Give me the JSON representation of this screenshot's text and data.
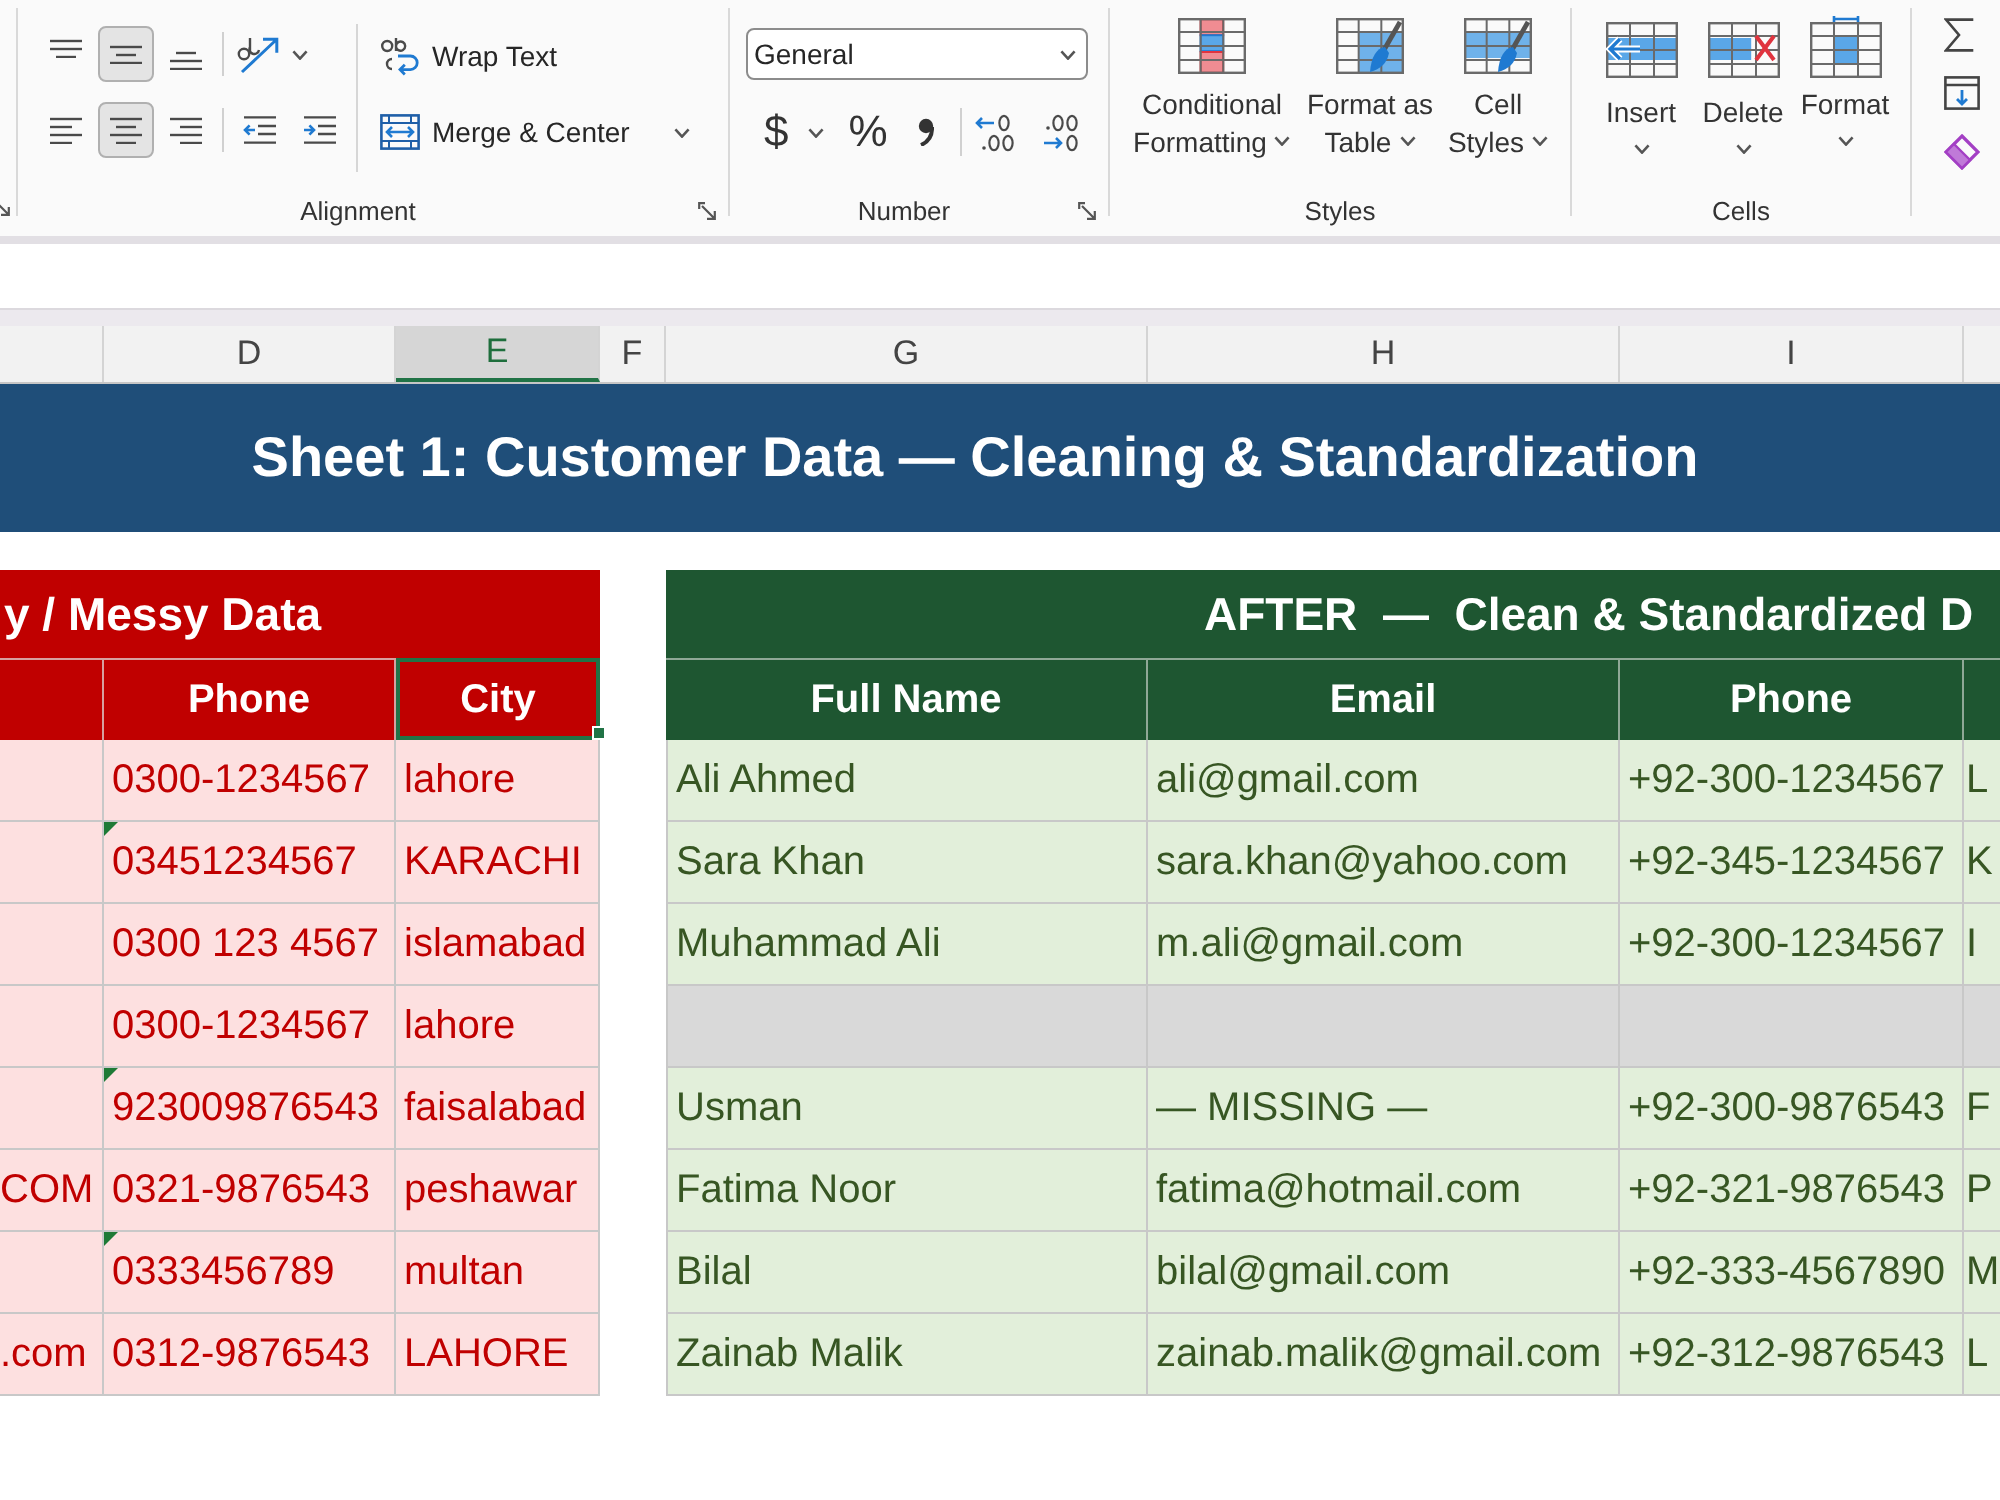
{
  "ribbon": {
    "alignment": {
      "label": "Alignment",
      "vertical": [
        {
          "kind": "top",
          "selected": false
        },
        {
          "kind": "middle",
          "selected": true
        },
        {
          "kind": "bottom",
          "selected": false
        }
      ],
      "horizontal": [
        {
          "kind": "left",
          "selected": false
        },
        {
          "kind": "center",
          "selected": true
        },
        {
          "kind": "right",
          "selected": false
        }
      ],
      "wrap_text": "Wrap Text",
      "merge_center": "Merge & Center"
    },
    "number": {
      "label": "Number",
      "format": "General",
      "currency": "$",
      "percent": "%"
    },
    "styles": {
      "label": "Styles",
      "buttons": [
        {
          "kind": "conditional",
          "lines": [
            "Conditional",
            "Formatting"
          ]
        },
        {
          "kind": "table",
          "lines": [
            "Format as",
            "Table"
          ]
        },
        {
          "kind": "cell_styles",
          "lines": [
            "Cell",
            "Styles"
          ]
        }
      ]
    },
    "cells": {
      "label": "Cells",
      "buttons": [
        {
          "kind": "insert",
          "label": "Insert"
        },
        {
          "kind": "delete",
          "label": "Delete"
        },
        {
          "kind": "format",
          "label": "Format"
        }
      ]
    }
  },
  "sheet": {
    "column_headers": [
      {
        "label": "D",
        "selected": false
      },
      {
        "label": "E",
        "selected": true
      },
      {
        "label": "F",
        "selected": false
      },
      {
        "label": "G",
        "selected": false
      },
      {
        "label": "H",
        "selected": false
      },
      {
        "label": "I",
        "selected": false
      }
    ],
    "title": "Sheet 1: Customer Data — Cleaning & Standardization",
    "before": {
      "title": "y / Messy Data",
      "columns": [
        {
          "label": "Phone",
          "selected": false
        },
        {
          "label": "City",
          "selected": true
        }
      ],
      "rows": [
        {
          "phone": "0300-1234567",
          "city": "lahore",
          "error_flag": false
        },
        {
          "phone": "03451234567",
          "city": "KARACHI",
          "error_flag": true
        },
        {
          "phone": "0300 123 4567",
          "city": "islamabad",
          "error_flag": false
        },
        {
          "phone": "0300-1234567",
          "city": "lahore",
          "error_flag": false
        },
        {
          "phone": "923009876543",
          "city": "faisalabad",
          "error_flag": true
        },
        {
          "column_c": "COM",
          "phone": "0321-9876543",
          "city": "peshawar",
          "error_flag": false
        },
        {
          "phone": "0333456789",
          "city": "multan",
          "error_flag": true
        },
        {
          "column_c": ".com",
          "phone": "0312-9876543",
          "city": "LAHORE",
          "error_flag": false
        }
      ]
    },
    "after": {
      "title": "AFTER  —  Clean & Standardized D",
      "columns": [
        "Full Name",
        "Email",
        "Phone"
      ],
      "rows": [
        {
          "kind": "data",
          "full_name": "Ali Ahmed",
          "email": "ali@gmail.com",
          "phone": "+92-300-1234567",
          "column_4": "L"
        },
        {
          "kind": "data",
          "full_name": "Sara Khan",
          "email": "sara.khan@yahoo.com",
          "phone": "+92-345-1234567",
          "column_4": "K"
        },
        {
          "kind": "data",
          "full_name": "Muhammad Ali",
          "email": "m.ali@gmail.com",
          "phone": "+92-300-1234567",
          "column_4": "I"
        },
        {
          "kind": "blank"
        },
        {
          "kind": "data",
          "full_name": "Usman",
          "email": "— MISSING —",
          "phone": "+92-300-9876543",
          "column_4": "F"
        },
        {
          "kind": "data",
          "full_name": "Fatima Noor",
          "email": "fatima@hotmail.com",
          "phone": "+92-321-9876543",
          "column_4": "P"
        },
        {
          "kind": "data",
          "full_name": "Bilal",
          "email": "bilal@gmail.com",
          "phone": "+92-333-4567890",
          "column_4": "M"
        },
        {
          "kind": "data",
          "full_name": "Zainab Malik",
          "email": "zainab.malik@gmail.com",
          "phone": "+92-312-9876543",
          "column_4": "L"
        }
      ]
    }
  }
}
